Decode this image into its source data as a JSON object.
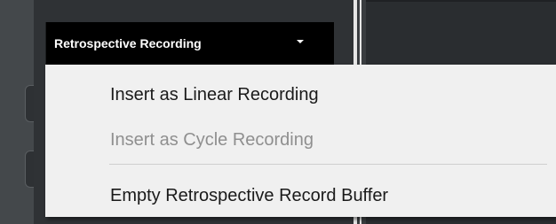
{
  "dropdown": {
    "label": "Retrospective Recording",
    "caret_icon": "chevron-down-icon"
  },
  "menu": {
    "items": [
      {
        "label": "Insert as Linear Recording",
        "enabled": true
      },
      {
        "label": "Insert as Cycle Recording",
        "enabled": false
      },
      {
        "label": "Empty Retrospective Record Buffer",
        "enabled": true
      }
    ]
  },
  "colors": {
    "header_bg": "#000000",
    "menu_bg": "#f0f0f0",
    "disabled_text": "#8f8f8f",
    "app_bg": "#3a3d40"
  }
}
